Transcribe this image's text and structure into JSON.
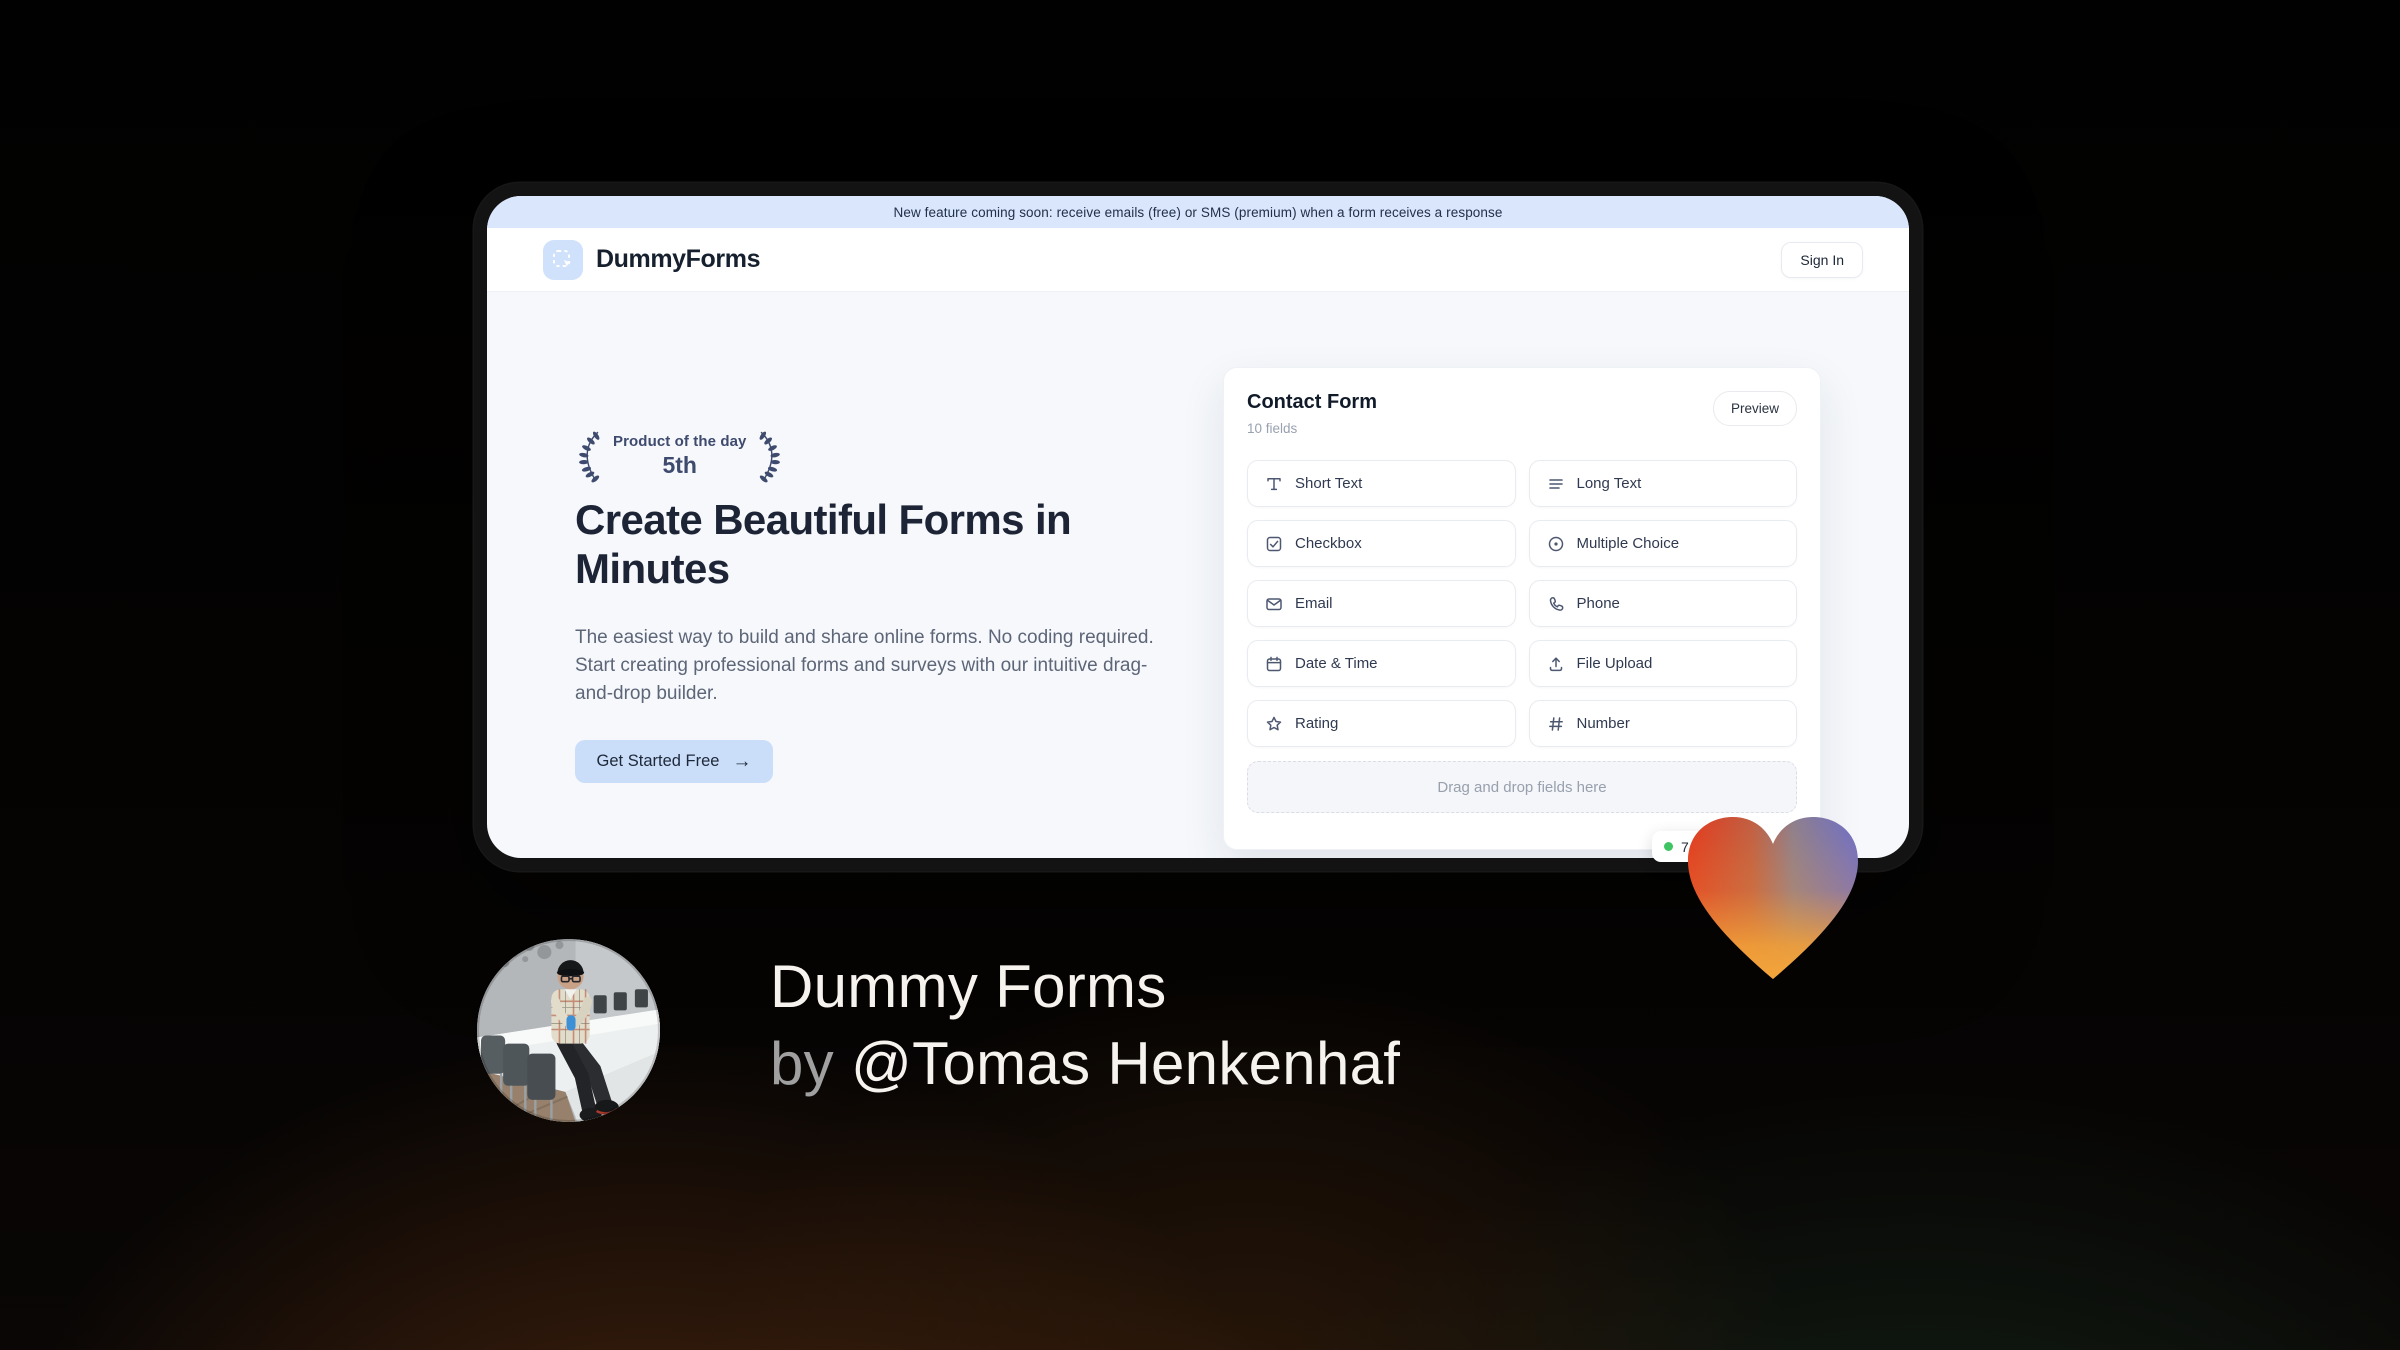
{
  "banner": {
    "text": "New feature coming soon: receive emails (free) or SMS (premium) when a form receives a response"
  },
  "header": {
    "brand": "DummyForms",
    "sign_in": "Sign In"
  },
  "hero": {
    "award": {
      "top": "Product of the day",
      "rank": "5th"
    },
    "title": "Create Beautiful Forms in Minutes",
    "description": "The easiest way to build and share online forms. No coding required. Start creating professional forms and surveys with our intuitive drag-and-drop builder.",
    "cta": "Get Started Free",
    "cta_arrow": "→"
  },
  "form_builder": {
    "title": "Contact Form",
    "subtitle": "10 fields",
    "preview": "Preview",
    "fields": [
      {
        "label": "Short Text",
        "icon": "text-icon"
      },
      {
        "label": "Long Text",
        "icon": "lines-icon"
      },
      {
        "label": "Checkbox",
        "icon": "checkbox-icon"
      },
      {
        "label": "Multiple Choice",
        "icon": "radio-icon"
      },
      {
        "label": "Email",
        "icon": "envelope-icon"
      },
      {
        "label": "Phone",
        "icon": "phone-icon"
      },
      {
        "label": "Date & Time",
        "icon": "calendar-icon"
      },
      {
        "label": "File Upload",
        "icon": "upload-icon"
      },
      {
        "label": "Rating",
        "icon": "star-icon"
      },
      {
        "label": "Number",
        "icon": "hash-icon"
      }
    ],
    "dropzone": "Drag and drop fields here",
    "status_badge": {
      "value": "7",
      "dot_color": "#3fc463"
    }
  },
  "footer": {
    "title": "Dummy Forms",
    "by": "by",
    "author": "@Tomas Henkenhaf"
  },
  "colors": {
    "banner_bg": "#d9e6fb",
    "accent_button": "#cadef9",
    "headline": "#1d2435",
    "award": "#3e4a6e",
    "heart_red": "#e13a20",
    "heart_orange": "#f2a037",
    "heart_blue": "#6b6ecb",
    "status_green": "#3fc463"
  }
}
